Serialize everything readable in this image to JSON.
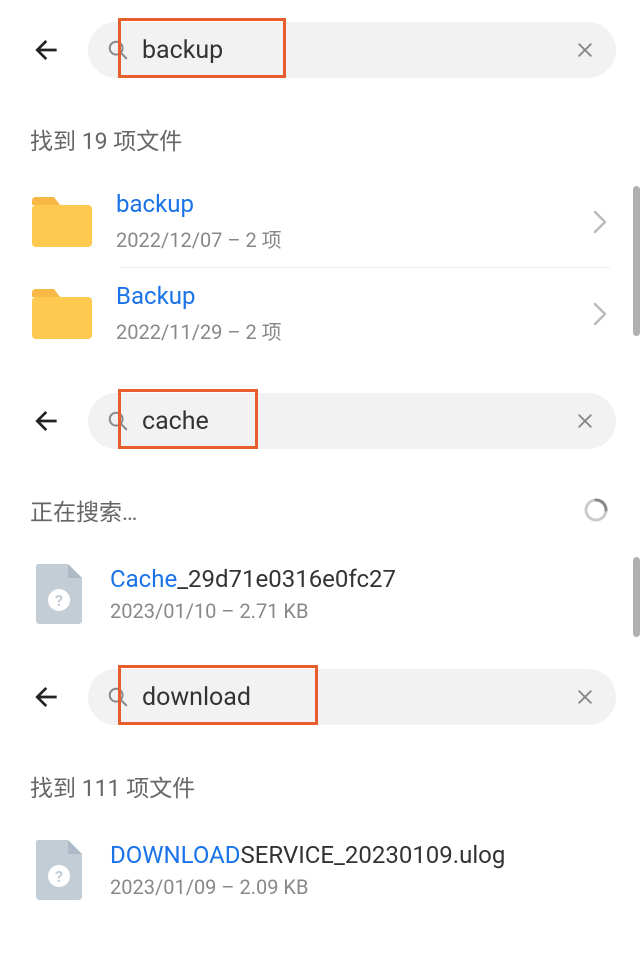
{
  "section1": {
    "search_query": "backup",
    "status": "找到 19 项文件",
    "items": [
      {
        "type": "folder",
        "name_hl": "backup",
        "name_rest": "",
        "meta": "2022/12/07 – 2 项"
      },
      {
        "type": "folder",
        "name_hl": "Backup",
        "name_rest": "",
        "meta": "2022/11/29 – 2 项"
      }
    ]
  },
  "section2": {
    "search_query": "cache",
    "status": "正在搜索…",
    "items": [
      {
        "type": "file",
        "name_hl": "Cache",
        "name_rest": "_29d71e0316e0fc27",
        "meta": "2023/01/10 – 2.71 KB"
      }
    ]
  },
  "section3": {
    "search_query": "download",
    "status": "找到 111 项文件",
    "items": [
      {
        "type": "file",
        "name_hl": "DOWNLOAD",
        "name_rest": "SERVICE_20230109.ulog",
        "meta": "2023/01/09 – 2.09 KB"
      }
    ]
  }
}
